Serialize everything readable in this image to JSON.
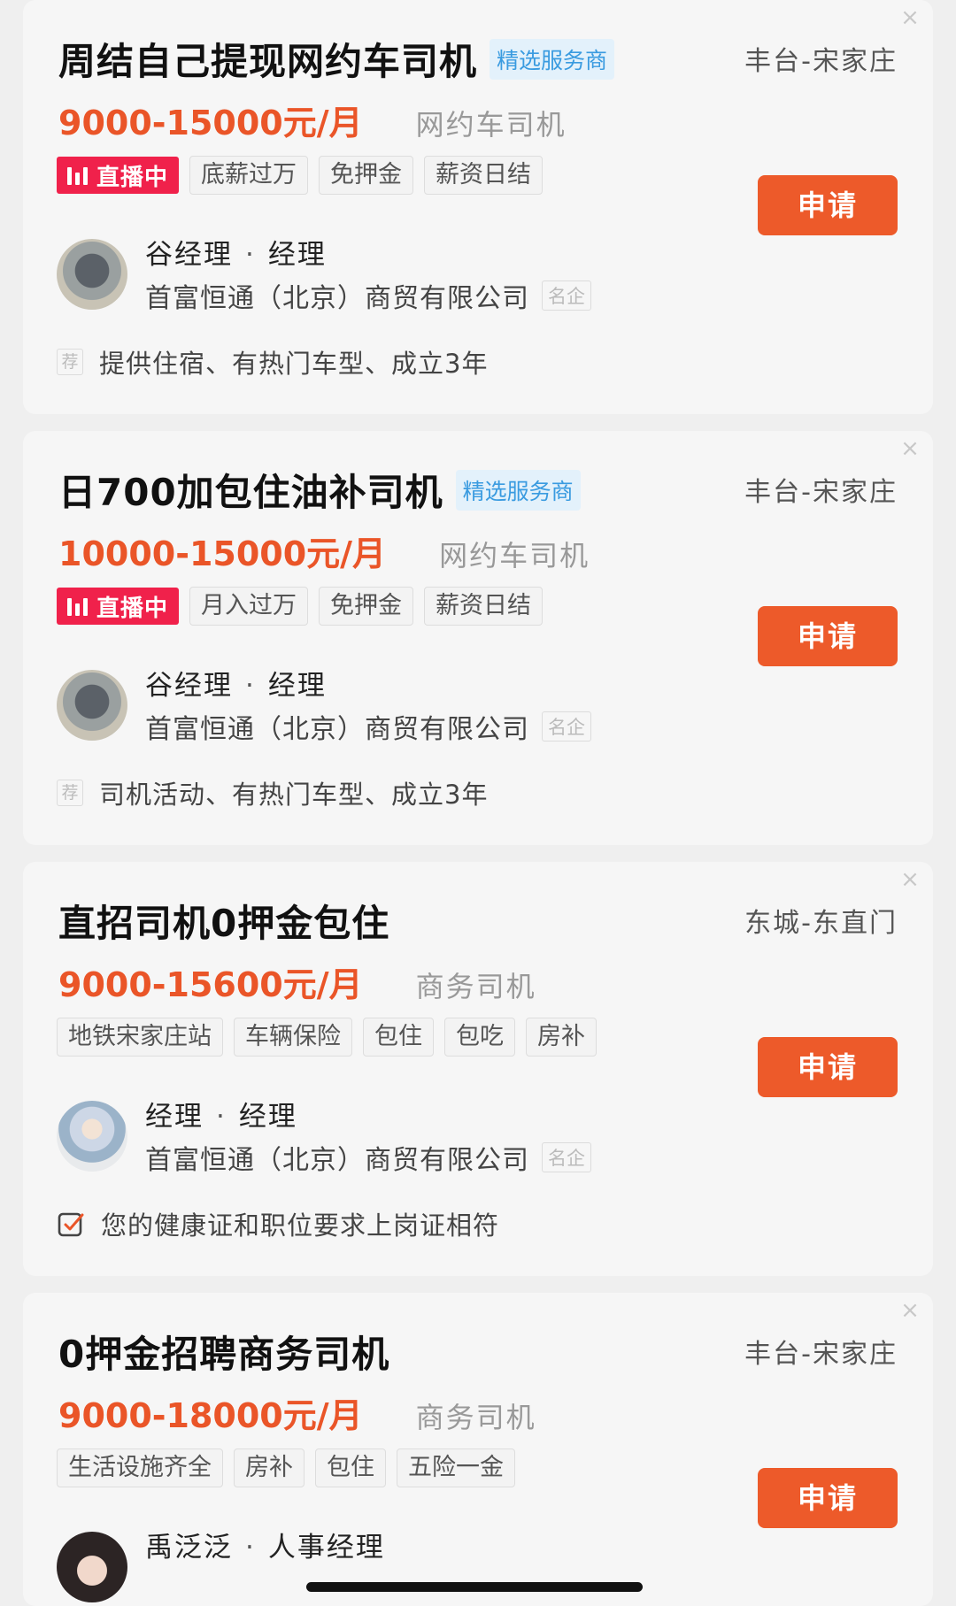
{
  "live_label": "直播中",
  "apply_label": "申请",
  "name_separator": "·",
  "close_glyph": "×",
  "colors": {
    "salary": "#ea5528",
    "apply_button": "#ed5a2a",
    "live_badge": "#f0214b",
    "select_badge_text": "#3a9be0"
  },
  "cards": [
    {
      "title": "周结自己提现网约车司机",
      "badge": "精选服务商",
      "location": "丰台-宋家庄",
      "salary": "9000-15000元/月",
      "job_type": "网约车司机",
      "tags": [
        "底薪过万",
        "免押金",
        "薪资日结"
      ],
      "recruiter_name": "谷经理",
      "recruiter_title": "经理",
      "company": "首富恒通（北京）商贸有限公司",
      "company_badge": "名企",
      "rec_icon": "荐",
      "rec_text": "提供住宿、有热门车型、成立3年"
    },
    {
      "title": "日700加包住油补司机",
      "badge": "精选服务商",
      "location": "丰台-宋家庄",
      "salary": "10000-15000元/月",
      "job_type": "网约车司机",
      "tags": [
        "月入过万",
        "免押金",
        "薪资日结"
      ],
      "recruiter_name": "谷经理",
      "recruiter_title": "经理",
      "company": "首富恒通（北京）商贸有限公司",
      "company_badge": "名企",
      "rec_icon": "荐",
      "rec_text": "司机活动、有热门车型、成立3年"
    },
    {
      "title": "直招司机0押金包住",
      "location": "东城-东直门",
      "salary": "9000-15600元/月",
      "job_type": "商务司机",
      "tags": [
        "地铁宋家庄站",
        "车辆保险",
        "包住",
        "包吃",
        "房补"
      ],
      "recruiter_name": "经理",
      "recruiter_title": "经理",
      "company": "首富恒通（北京）商贸有限公司",
      "company_badge": "名企",
      "rec_text": "您的健康证和职位要求上岗证相符"
    },
    {
      "title": "0押金招聘商务司机",
      "location": "丰台-宋家庄",
      "salary": "9000-18000元/月",
      "job_type": "商务司机",
      "tags": [
        "生活设施齐全",
        "房补",
        "包住",
        "五险一金"
      ],
      "recruiter_name": "禹泛泛",
      "recruiter_title": "人事经理"
    }
  ]
}
